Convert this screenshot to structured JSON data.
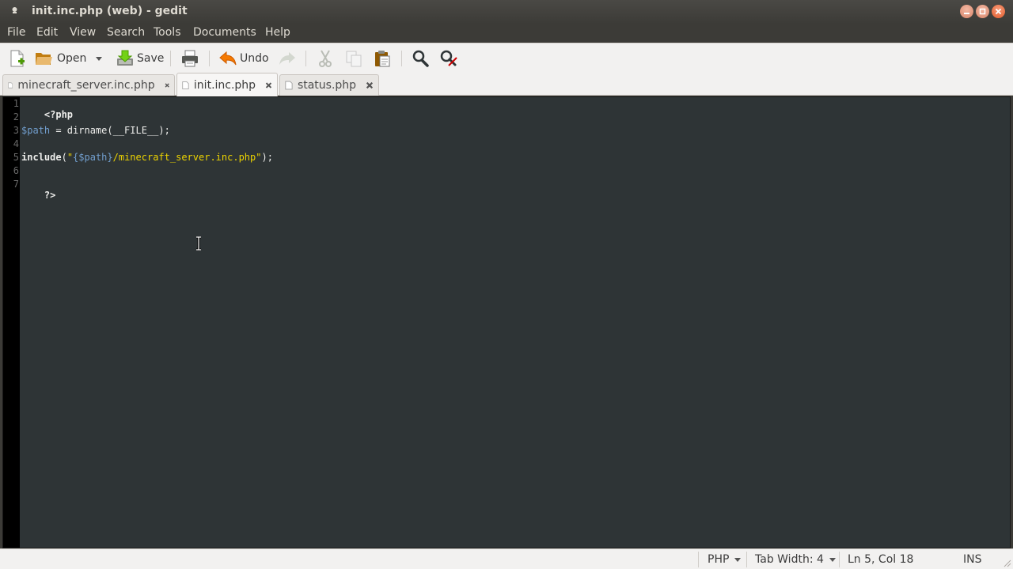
{
  "window": {
    "title": "init.inc.php (web) - gedit"
  },
  "menubar": {
    "items": [
      "File",
      "Edit",
      "View",
      "Search",
      "Tools",
      "Documents",
      "Help"
    ]
  },
  "toolbar": {
    "open_label": "Open",
    "save_label": "Save",
    "undo_label": "Undo"
  },
  "tabs": [
    {
      "label": "minecraft_server.inc.php",
      "active": false
    },
    {
      "label": "init.inc.php",
      "active": true
    },
    {
      "label": "status.php",
      "active": false
    }
  ],
  "editor": {
    "line_numbers": [
      "1",
      "2",
      "3",
      "4",
      "5",
      "6",
      "7"
    ],
    "lines": {
      "l1": "<?php",
      "l3_var": "$path",
      "l3_rest": " = dirname(__FILE__);",
      "l5_kw": "include",
      "l5_open": "(",
      "l5_q1": "\"",
      "l5_var": "{$path}",
      "l5_str": "/minecraft_server.inc.php\"",
      "l5_close": ");",
      "l7": "?>"
    }
  },
  "statusbar": {
    "language": "PHP",
    "tab_width": "Tab Width: 4",
    "position": "Ln 5, Col 18",
    "mode": "INS"
  },
  "colors": {
    "editor_bg": "#2e3436",
    "gutter_bg": "#000000",
    "variable": "#729fcf",
    "string": "#edd400",
    "close_accent": "#e35d2d"
  }
}
